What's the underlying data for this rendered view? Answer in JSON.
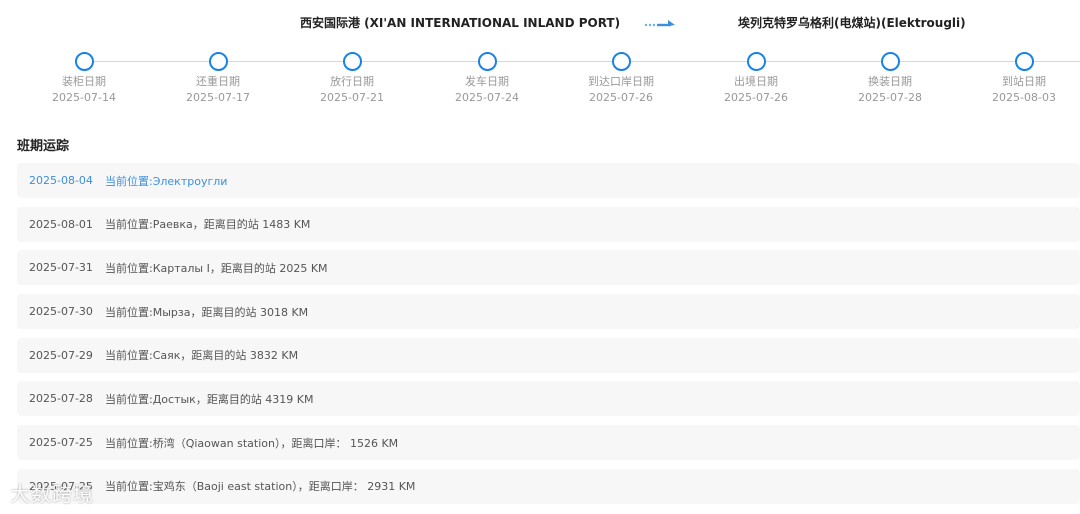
{
  "route": {
    "origin": "西安国际港 (XI'AN INTERNATIONAL INLAND PORT)",
    "destination": "埃列克特罗乌格利(电煤站)(Elektrougli)"
  },
  "milestones": [
    {
      "label": "装柜日期",
      "date": "2025-07-14"
    },
    {
      "label": "还重日期",
      "date": "2025-07-17"
    },
    {
      "label": "放行日期",
      "date": "2025-07-21"
    },
    {
      "label": "发车日期",
      "date": "2025-07-24"
    },
    {
      "label": "到达口岸日期",
      "date": "2025-07-26"
    },
    {
      "label": "出境日期",
      "date": "2025-07-26"
    },
    {
      "label": "换装日期",
      "date": "2025-07-28"
    },
    {
      "label": "到站日期",
      "date": "2025-08-03"
    }
  ],
  "tracking": {
    "title": "班期运踪",
    "rows": [
      {
        "date": "2025-08-04",
        "text": "当前位置:Электроугли"
      },
      {
        "date": "2025-08-01",
        "text": "当前位置:Раевка，距离目的站 1483 KM"
      },
      {
        "date": "2025-07-31",
        "text": "当前位置:Карталы I，距离目的站 2025 KM"
      },
      {
        "date": "2025-07-30",
        "text": "当前位置:Мырза，距离目的站 3018 KM"
      },
      {
        "date": "2025-07-29",
        "text": "当前位置:Саяк，距离目的站 3832 KM"
      },
      {
        "date": "2025-07-28",
        "text": "当前位置:Достык，距离目的站 4319 KM"
      },
      {
        "date": "2025-07-25",
        "text": "当前位置:桥湾（Qiaowan station），距离口岸： 1526 KM"
      },
      {
        "date": "2025-07-25",
        "text": "当前位置:宝鸡东（Baoji east station），距离口岸： 2931 KM"
      }
    ]
  },
  "colors": {
    "accent": "#1a82e6",
    "latest_text": "#3d8fdd"
  },
  "watermark": "大数跨境"
}
